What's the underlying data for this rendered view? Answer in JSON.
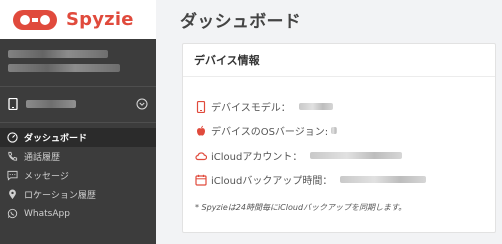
{
  "brand": {
    "name": "Spyzie",
    "accent": "#e04a3c"
  },
  "page": {
    "title": "ダッシュボード"
  },
  "sidebar": {
    "background": "#3c3c3c",
    "nav": [
      {
        "label": "ダッシュボード",
        "icon": "dashboard-icon",
        "active": true
      },
      {
        "label": "通話履歴",
        "icon": "phone-icon",
        "active": false
      },
      {
        "label": "メッセージ",
        "icon": "message-icon",
        "active": false
      },
      {
        "label": "ロケーション履歴",
        "icon": "location-pin-icon",
        "active": false
      },
      {
        "label": "WhatsApp",
        "icon": "whatsapp-icon",
        "active": false
      }
    ]
  },
  "card": {
    "title": "デバイス情報",
    "rows": [
      {
        "label": "デバイスモデル：",
        "icon": "smartphone-icon"
      },
      {
        "label": "デバイスのOSバージョン:",
        "icon": "apple-icon"
      },
      {
        "label": "iCloudアカウント：",
        "icon": "cloud-icon"
      },
      {
        "label": "iCloudバックアップ時間：",
        "icon": "calendar-icon"
      }
    ],
    "note": "* Spyzieは24時間毎にiCloudバックアップを同期します。"
  }
}
